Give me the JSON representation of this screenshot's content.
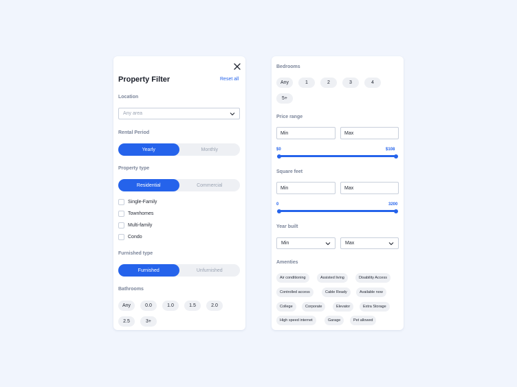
{
  "filter": {
    "title": "Property Filter",
    "reset_label": "Reset all",
    "location": {
      "label": "Location",
      "placeholder": "Any area"
    },
    "rental_period": {
      "label": "Rental Period",
      "options": [
        "Yearly",
        "Monthly"
      ],
      "selected": "Yearly"
    },
    "property_type": {
      "label": "Property type",
      "options": [
        "Residential",
        "Commercial"
      ],
      "selected": "Residential"
    },
    "property_checkboxes": [
      "Single-Family",
      "Townhomes",
      "Multi-family",
      "Condo"
    ],
    "furnished": {
      "label": "Furnished type",
      "options": [
        "Furnished",
        "Unfurnished"
      ],
      "selected": "Furnished"
    },
    "bathrooms": {
      "label": "Bathrooms",
      "options": [
        "Any",
        "0.0",
        "1.0",
        "1.5",
        "2.0",
        "2.5",
        "3+"
      ]
    }
  },
  "details": {
    "bedrooms": {
      "label": "Bedrooms",
      "options": [
        "Any",
        "1",
        "2",
        "3",
        "4",
        "5+"
      ]
    },
    "price_range": {
      "label": "Price range",
      "min_placeholder": "Min",
      "max_placeholder": "Max",
      "min_value": "$0",
      "max_value": "$108"
    },
    "square_feet": {
      "label": "Square feet",
      "min_placeholder": "Min",
      "max_placeholder": "Max",
      "min_value": "0",
      "max_value": "3200"
    },
    "year_built": {
      "label": "Year built",
      "min": "Min",
      "max": "Max"
    },
    "amenities": {
      "label": "Amenties",
      "items": [
        "Air conditioning",
        "Assisted living",
        "Disability Access",
        "Controlled access",
        "Cable Ready",
        "Available now",
        "College",
        "Corporate",
        "Elevator",
        "Extra Storage",
        "High speed internet",
        "Garage",
        "Pet allowed"
      ]
    }
  },
  "colors": {
    "accent": "#2563eb",
    "background": "#f1f5fd",
    "chip": "#eef0f4"
  }
}
